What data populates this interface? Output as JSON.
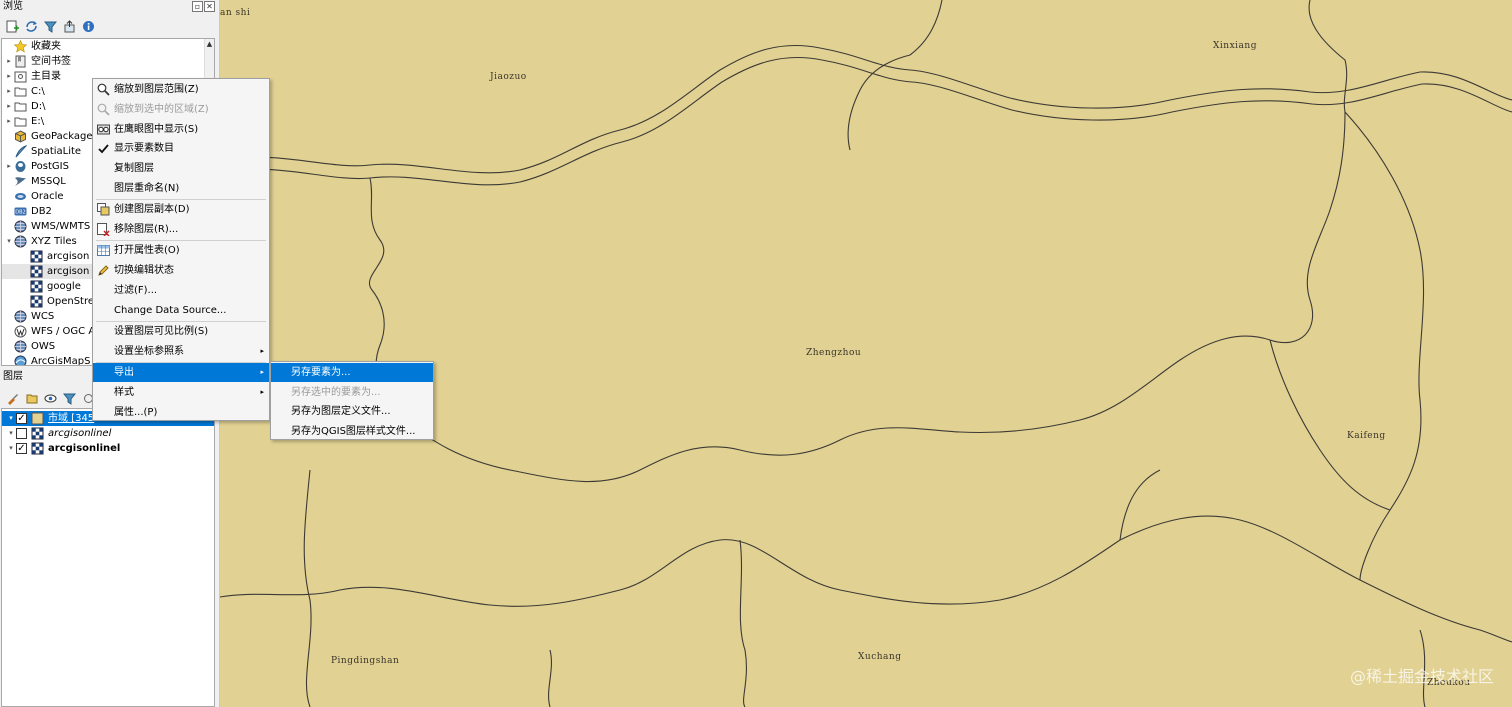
{
  "browser_panel": {
    "title": "浏览",
    "items": [
      {
        "label": "收藏夹",
        "icon": "star-icon",
        "arrow": ""
      },
      {
        "label": "空间书签",
        "icon": "bookmark-icon",
        "arrow": "▸"
      },
      {
        "label": "主目录",
        "icon": "home-folder-icon",
        "arrow": "▸"
      },
      {
        "label": "C:\\",
        "icon": "folder-icon",
        "arrow": "▸"
      },
      {
        "label": "D:\\",
        "icon": "folder-icon",
        "arrow": "▸"
      },
      {
        "label": "E:\\",
        "icon": "folder-icon",
        "arrow": "▸"
      },
      {
        "label": "GeoPackage",
        "icon": "geopackage-icon",
        "arrow": ""
      },
      {
        "label": "SpatiaLite",
        "icon": "spatialite-icon",
        "arrow": ""
      },
      {
        "label": "PostGIS",
        "icon": "postgis-icon",
        "arrow": "▸"
      },
      {
        "label": "MSSQL",
        "icon": "mssql-icon",
        "arrow": ""
      },
      {
        "label": "Oracle",
        "icon": "oracle-icon",
        "arrow": ""
      },
      {
        "label": "DB2",
        "icon": "db2-icon",
        "arrow": ""
      },
      {
        "label": "WMS/WMTS",
        "icon": "globe-icon",
        "arrow": ""
      },
      {
        "label": "XYZ Tiles",
        "icon": "globe-icon",
        "arrow": "▾"
      },
      {
        "label": "arcgison",
        "icon": "tiles-icon",
        "arrow": "",
        "indent": true
      },
      {
        "label": "arcgison",
        "icon": "tiles-icon",
        "arrow": "",
        "indent": true,
        "selected": true
      },
      {
        "label": "google",
        "icon": "tiles-icon",
        "arrow": "",
        "indent": true
      },
      {
        "label": "OpenStre",
        "icon": "tiles-icon",
        "arrow": "",
        "indent": true
      },
      {
        "label": "WCS",
        "icon": "globe-icon",
        "arrow": ""
      },
      {
        "label": "WFS / OGC A",
        "icon": "wfs-icon",
        "arrow": ""
      },
      {
        "label": "OWS",
        "icon": "globe-icon",
        "arrow": ""
      },
      {
        "label": "ArcGisMapS",
        "icon": "arcgis-icon",
        "arrow": ""
      }
    ]
  },
  "layers_panel": {
    "title": "图层",
    "layers": [
      {
        "label": "市域 [345",
        "checked": true,
        "highlight": true
      },
      {
        "label": "arcgisonlinel",
        "checked": false,
        "italic": true
      },
      {
        "label": "arcgisonlinel",
        "checked": true,
        "bold": true
      }
    ]
  },
  "context_menu": {
    "items": [
      {
        "label": "缩放到图层范围(Z)",
        "icon": "zoom-layer-icon"
      },
      {
        "label": "缩放到选中的区域(Z)",
        "icon": "zoom-selection-icon",
        "disabled": true
      },
      {
        "label": "在鹰眼图中显示(S)",
        "icon": "overview-icon"
      },
      {
        "label": "显示要素数目",
        "icon": "check-icon"
      },
      {
        "label": "复制图层",
        "icon": ""
      },
      {
        "label": "图层重命名(N)",
        "icon": ""
      },
      {
        "label": "创建图层副本(D)",
        "icon": "duplicate-layer-icon"
      },
      {
        "label": "移除图层(R)...",
        "icon": "remove-layer-icon"
      },
      {
        "label": "打开属性表(O)",
        "icon": "attribute-table-icon"
      },
      {
        "label": "切换编辑状态",
        "icon": "pencil-icon"
      },
      {
        "label": "过滤(F)...",
        "icon": ""
      },
      {
        "label": "Change Data Source...",
        "icon": ""
      },
      {
        "label": "设置图层可见比例(S)",
        "icon": ""
      },
      {
        "label": "设置坐标参照系",
        "icon": "",
        "submenu": true
      },
      {
        "label": "导出",
        "icon": "",
        "submenu": true,
        "active": true
      },
      {
        "label": "样式",
        "icon": "",
        "submenu": true
      },
      {
        "label": "属性...(P)",
        "icon": ""
      }
    ],
    "submenu_arrow": "▸"
  },
  "export_submenu": {
    "items": [
      {
        "label": "另存要素为...",
        "active": true
      },
      {
        "label": "另存选中的要素为...",
        "disabled": true
      },
      {
        "label": "另存为图层定义文件..."
      },
      {
        "label": "另存为QGIS图层样式文件..."
      }
    ]
  },
  "map": {
    "background": "#e1d193",
    "labels": [
      "an shi",
      "Jiaozuo",
      "Xinxiang",
      "Zhengzhou",
      "Kaifeng",
      "Pingdingshan",
      "Xuchang",
      "Zhoukou"
    ],
    "watermark": "@稀土掘金技术社区"
  }
}
